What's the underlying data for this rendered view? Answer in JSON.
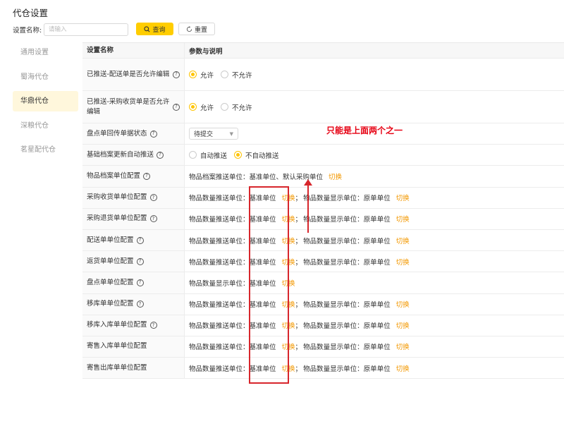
{
  "page": {
    "title": "代仓设置"
  },
  "search": {
    "label": "设置名称:",
    "placeholder": "请输入",
    "query_label": "查询",
    "reset_label": "重置"
  },
  "sidebar": {
    "items": [
      {
        "label": "通用设置",
        "active": false
      },
      {
        "label": "蜀海代仓",
        "active": false
      },
      {
        "label": "华鼎代仓",
        "active": true
      },
      {
        "label": "深粮代仓",
        "active": false
      },
      {
        "label": "茗星配代仓",
        "active": false
      }
    ]
  },
  "table": {
    "headers": [
      "设置名称",
      "参数与说明"
    ],
    "rows": [
      {
        "name": "已推送-配送单是否允许编辑",
        "options": [
          "允许",
          "不允许"
        ],
        "selected": 0
      },
      {
        "name": "已推送-采购收货单是否允许编辑",
        "options": [
          "允许",
          "不允许"
        ],
        "selected": 0
      },
      {
        "name": "盘点单回传单据状态",
        "select_value": "待提交"
      },
      {
        "name": "基础档案更新自动推送",
        "options": [
          "自动推送",
          "不自动推送"
        ],
        "selected": 1
      },
      {
        "name": "物品档案单位配置",
        "text": "物品档案推送单位：基准单位、默认采购单位",
        "link": "切换"
      },
      {
        "name": "采购收货单单位配置",
        "push_label": "物品数量推送单位：",
        "push_value": "基准单位",
        "link": "切换",
        "show_label": "物品数量显示单位：",
        "show_value": "原单单位",
        "link2": "切换"
      },
      {
        "name": "采购退货单单位配置",
        "push_label": "物品数量推送单位：",
        "push_value": "基准单位",
        "link": "切换",
        "show_label": "物品数量显示单位：",
        "show_value": "原单单位",
        "link2": "切换"
      },
      {
        "name": "配送单单位配置",
        "push_label": "物品数量推送单位：",
        "push_value": "基准单位",
        "link": "切换",
        "show_label": "物品数量显示单位：",
        "show_value": "原单单位",
        "link2": "切换"
      },
      {
        "name": "返货单单位配置",
        "push_label": "物品数量推送单位：",
        "push_value": "基准单位",
        "link": "切换",
        "show_label": "物品数量显示单位：",
        "show_value": "原单单位",
        "link2": "切换"
      },
      {
        "name": "盘点单单位配置",
        "push_label": "物品数量显示单位：",
        "push_value": "基准单位",
        "link": "切换"
      },
      {
        "name": "移库单单位配置",
        "push_label": "物品数量推送单位：",
        "push_value": "基准单位",
        "link": "切换",
        "show_label": "物品数量显示单位：",
        "show_value": "原单单位",
        "link2": "切换"
      },
      {
        "name": "移库入库单单位配置",
        "push_label": "物品数量推送单位：",
        "push_value": "基准单位",
        "link": "切换",
        "show_label": "物品数量显示单位：",
        "show_value": "原单单位",
        "link2": "切换"
      },
      {
        "name": "寄售入库单单位配置",
        "push_label": "物品数量推送单位：",
        "push_value": "基准单位",
        "link": "切换",
        "show_label": "物品数量显示单位：",
        "show_value": "原单单位",
        "link2": "切换"
      },
      {
        "name": "寄售出库单单位配置",
        "push_label": "物品数量推送单位：",
        "push_value": "基准单位",
        "link": "切换",
        "show_label": "物品数量显示单位：",
        "show_value": "原单单位",
        "link2": "切换"
      }
    ]
  },
  "annotation": {
    "text": "只能是上面两个之一"
  },
  "colors": {
    "accent": "#ffcd00",
    "link": "#f39800",
    "annotation": "#e60012"
  }
}
